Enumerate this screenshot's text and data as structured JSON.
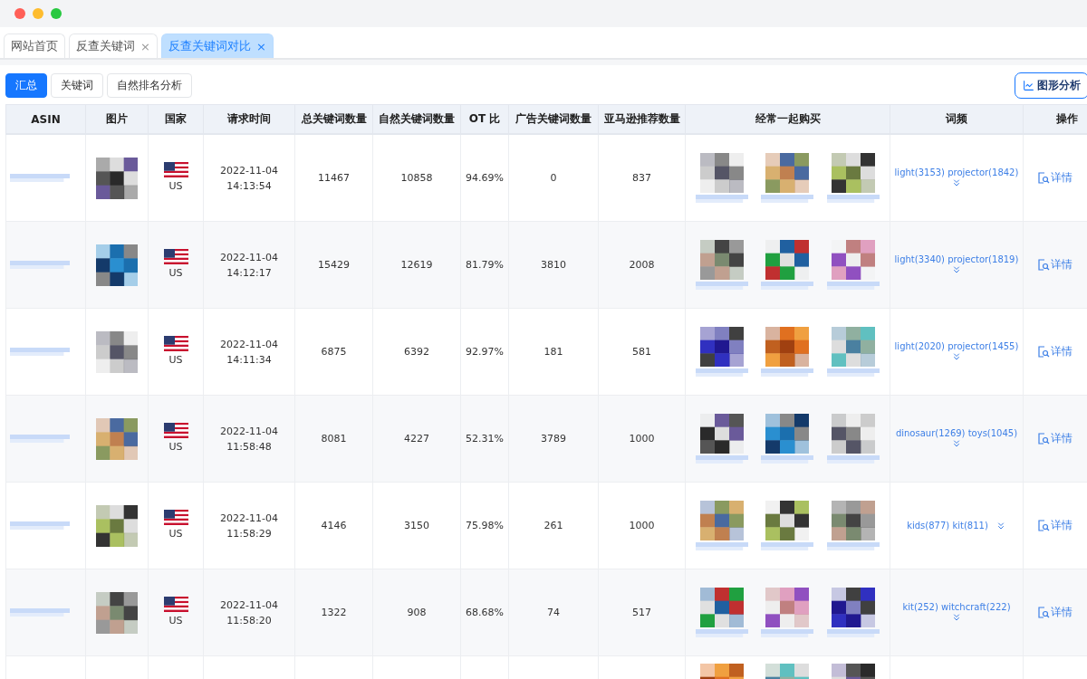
{
  "tabs": [
    {
      "label": "网站首页",
      "closable": false,
      "selected": false
    },
    {
      "label": "反查关键词",
      "closable": true,
      "selected": false
    },
    {
      "label": "反查关键词对比",
      "closable": true,
      "selected": true
    }
  ],
  "close_glyph": "×",
  "view_buttons": [
    {
      "label": "汇总",
      "selected": true
    },
    {
      "label": "关键词",
      "selected": false
    },
    {
      "label": "自然排名分析",
      "selected": false
    }
  ],
  "chart_button": {
    "label": "图形分析"
  },
  "table": {
    "columns": [
      "ASIN",
      "图片",
      "国家",
      "请求时间",
      "总关键词数量",
      "自然关键词数量",
      "OT 比",
      "广告关键词数量",
      "亚马逊推荐数量",
      "经常一起购买",
      "词频",
      "操作"
    ],
    "rows": [
      {
        "country": "US",
        "date": "2022-11-04",
        "time": "14:13:54",
        "total": "11467",
        "natural": "10858",
        "ot": "94.69%",
        "ads": "0",
        "amazon": "837",
        "freq": "light(3153) projector(1842)",
        "action": "详情"
      },
      {
        "country": "US",
        "date": "2022-11-04",
        "time": "14:12:17",
        "total": "15429",
        "natural": "12619",
        "ot": "81.79%",
        "ads": "3810",
        "amazon": "2008",
        "freq": "light(3340) projector(1819)",
        "action": "详情"
      },
      {
        "country": "US",
        "date": "2022-11-04",
        "time": "14:11:34",
        "total": "6875",
        "natural": "6392",
        "ot": "92.97%",
        "ads": "181",
        "amazon": "581",
        "freq": "light(2020) projector(1455)",
        "action": "详情"
      },
      {
        "country": "US",
        "date": "2022-11-04",
        "time": "11:58:48",
        "total": "8081",
        "natural": "4227",
        "ot": "52.31%",
        "ads": "3789",
        "amazon": "1000",
        "freq": "dinosaur(1269) toys(1045)",
        "action": "详情"
      },
      {
        "country": "US",
        "date": "2022-11-04",
        "time": "11:58:29",
        "total": "4146",
        "natural": "3150",
        "ot": "75.98%",
        "ads": "261",
        "amazon": "1000",
        "freq": "kids(877) kit(811)",
        "action": "详情"
      },
      {
        "country": "US",
        "date": "2022-11-04",
        "time": "11:58:20",
        "total": "1322",
        "natural": "908",
        "ot": "68.68%",
        "ads": "74",
        "amazon": "517",
        "freq": "kit(252) witchcraft(222)",
        "action": "详情"
      },
      {
        "partial": true
      }
    ]
  }
}
